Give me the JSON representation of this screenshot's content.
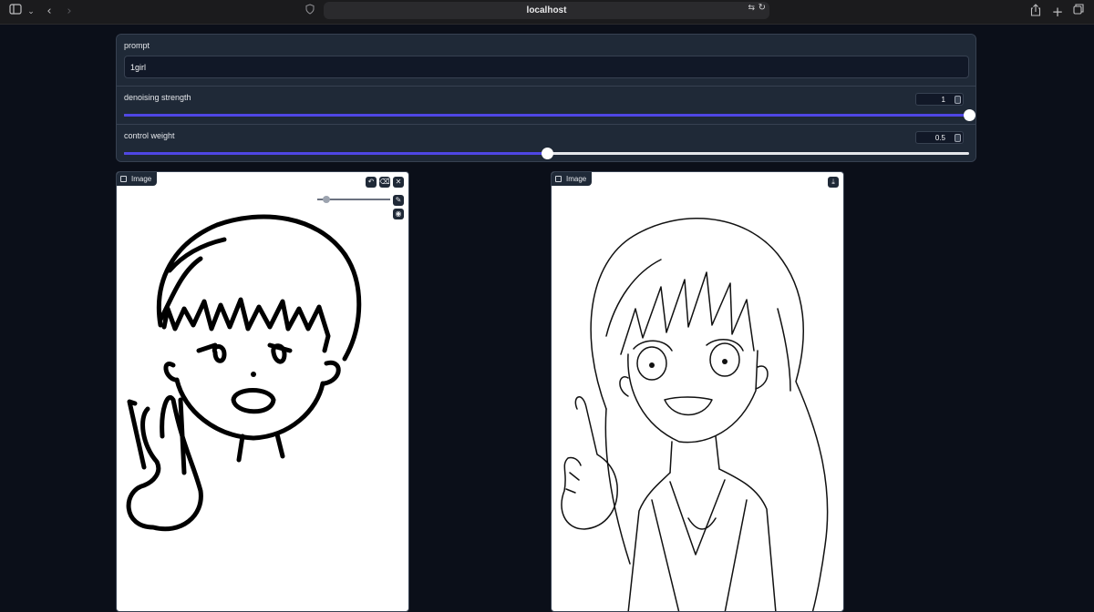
{
  "browser": {
    "url": "localhost",
    "icons": [
      "sidebar-icon",
      "chevron-down-icon",
      "back-icon",
      "forward-icon",
      "shield-icon",
      "translate-icon",
      "reload-icon",
      "share-icon",
      "new-tab-icon",
      "tabs-icon"
    ]
  },
  "controls": {
    "prompt": {
      "label": "prompt",
      "value": "1girl"
    },
    "denoising": {
      "label": "denoising strength",
      "value": "1",
      "fraction": 1.0
    },
    "control_weight": {
      "label": "control weight",
      "value": "0.5",
      "fraction": 0.5
    }
  },
  "input_image": {
    "label": "Image",
    "tools": [
      "undo-icon",
      "eraser-icon",
      "clear-icon",
      "brush-icon",
      "color-icon"
    ]
  },
  "output_image": {
    "label": "Image",
    "tools": [
      "download-icon"
    ]
  },
  "colors": {
    "background": "#0b0f19",
    "panel": "#1f2937",
    "accent": "#4f46e5"
  }
}
